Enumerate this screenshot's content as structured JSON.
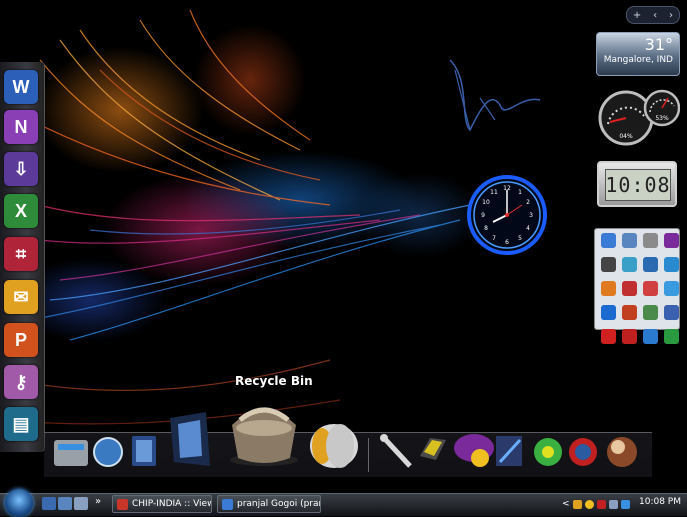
{
  "desktop": {
    "recycle_bin_label": "Recycle Bin"
  },
  "sidebar": {
    "top_controls": {
      "add": "+",
      "prev": "‹",
      "next": "›"
    },
    "weather": {
      "temperature": "31°",
      "location": "Mangalore, IND"
    },
    "cpu_meter": {
      "cpu_percent": "04%",
      "memory_percent": "53%"
    },
    "digital_clock": {
      "time": "10:08"
    }
  },
  "office_bar": {
    "items": [
      {
        "name": "word",
        "glyph": "W",
        "color": "#2b5fb8"
      },
      {
        "name": "onenote",
        "glyph": "N",
        "color": "#8a3fb5"
      },
      {
        "name": "infopath",
        "glyph": "⇩",
        "color": "#5b3a9a"
      },
      {
        "name": "excel",
        "glyph": "X",
        "color": "#2e8b3a"
      },
      {
        "name": "access",
        "glyph": "⌗",
        "color": "#b0243a"
      },
      {
        "name": "outlook",
        "glyph": "✉",
        "color": "#e0a020"
      },
      {
        "name": "powerpoint",
        "glyph": "P",
        "color": "#d2521e"
      },
      {
        "name": "key",
        "glyph": "⚷",
        "color": "#a05aa8"
      },
      {
        "name": "publisher",
        "glyph": "▤",
        "color": "#1f6b8c"
      }
    ]
  },
  "taskbar": {
    "windows": [
      {
        "label": "CHIP-INDIA :: View t...",
        "icon_color": "#c8362a"
      },
      {
        "label": "pranjal Gogoi (pranj...",
        "icon_color": "#3a7bd5"
      }
    ],
    "quicklaunch_more": "»",
    "tray_chevron": "<",
    "time": "10:08 PM"
  },
  "colors": {
    "accent": "#1a5cff"
  }
}
